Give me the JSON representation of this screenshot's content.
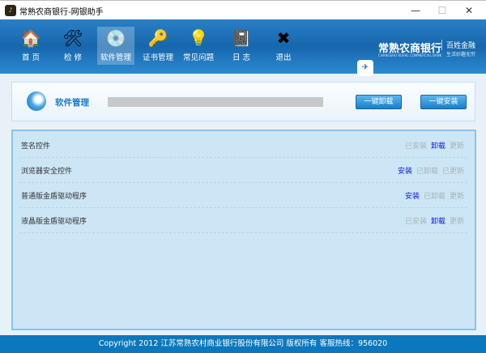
{
  "window": {
    "title": "常熟农商银行-网银助手",
    "minimize": "—",
    "maximize": "☐",
    "close": "✕"
  },
  "nav": [
    {
      "label": "首 页",
      "icon": "🏠"
    },
    {
      "label": "检 修",
      "icon": "🛠"
    },
    {
      "label": "软件管理",
      "icon": "💿"
    },
    {
      "label": "证书管理",
      "icon": "🔑"
    },
    {
      "label": "常见问题",
      "icon": "💡"
    },
    {
      "label": "日 志",
      "icon": "📓"
    },
    {
      "label": "退出",
      "icon": "✖"
    }
  ],
  "brand": {
    "name": "常熟农商银行",
    "english": "CHANGSHU RURAL COMMERCIAL BANK",
    "slogan": "百姓金融",
    "slogan2": "生活妙趣无穷"
  },
  "panel": {
    "title": "软件管理",
    "progress": 0,
    "uninstall_all": "一键卸载",
    "install_all": "一键安装"
  },
  "software": [
    {
      "name": "签名控件",
      "actions": [
        {
          "label": "已安装",
          "enabled": false
        },
        {
          "label": "卸载",
          "enabled": true
        },
        {
          "label": "更新",
          "enabled": false
        }
      ]
    },
    {
      "name": "浏览器安全控件",
      "actions": [
        {
          "label": "安装",
          "enabled": true
        },
        {
          "label": "已卸载",
          "enabled": false
        },
        {
          "label": "已更新",
          "enabled": false
        }
      ]
    },
    {
      "name": "普通版金盾驱动程序",
      "actions": [
        {
          "label": "安装",
          "enabled": true
        },
        {
          "label": "已卸载",
          "enabled": false
        },
        {
          "label": "更新",
          "enabled": false
        }
      ]
    },
    {
      "name": "液晶版金盾驱动程序",
      "actions": [
        {
          "label": "已安装",
          "enabled": false
        },
        {
          "label": "卸载",
          "enabled": true
        },
        {
          "label": "更新",
          "enabled": false
        }
      ]
    }
  ],
  "footer": "Copyright 2012 江苏常熟农村商业银行股份有限公司 版权所有    客服热线：956020"
}
